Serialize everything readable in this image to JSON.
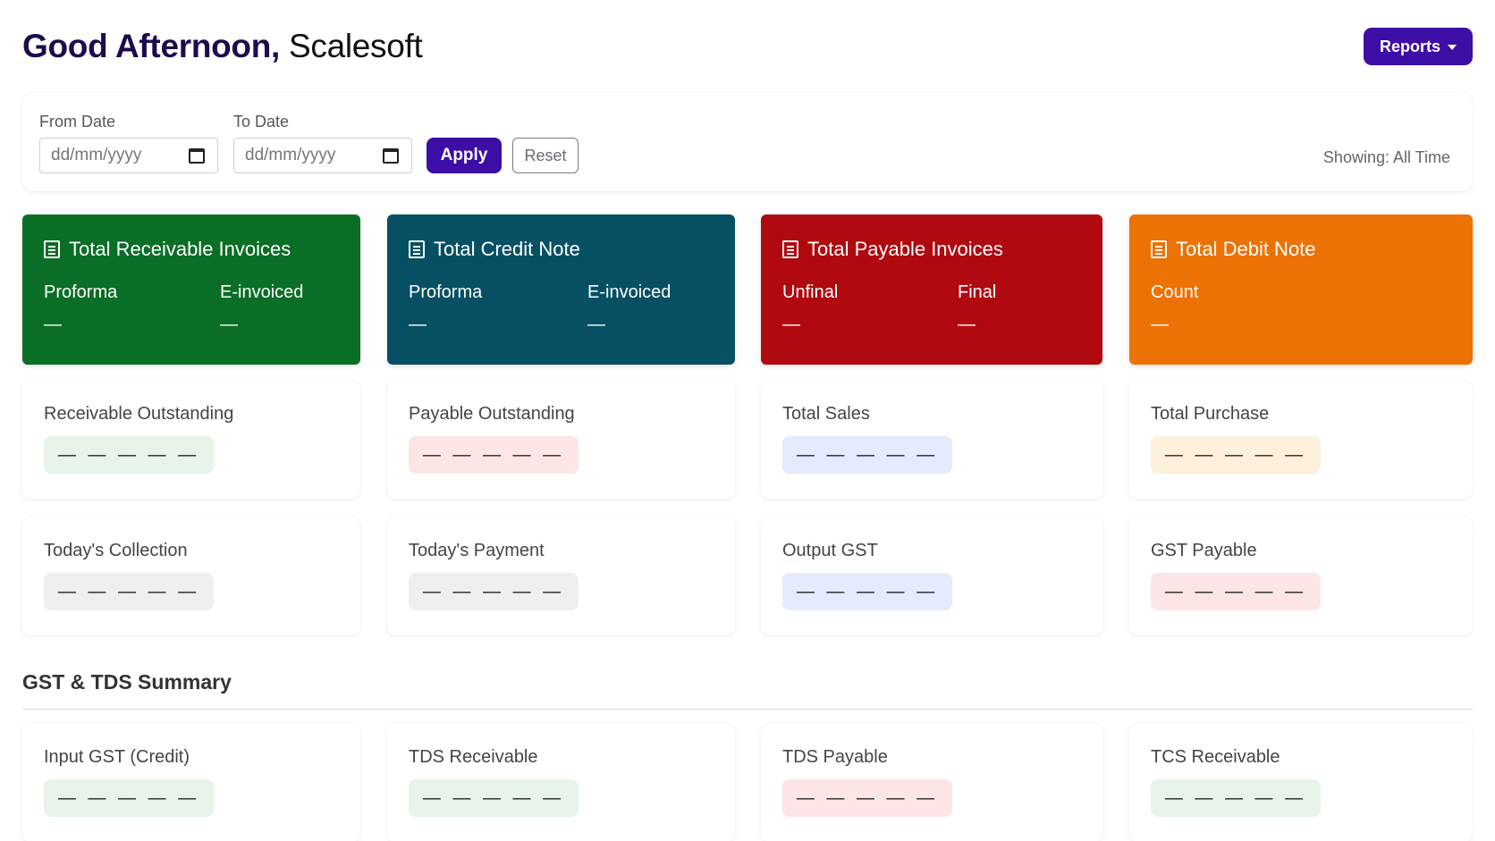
{
  "header": {
    "greeting": "Good Afternoon,",
    "name": "Scalesoft",
    "reports_label": "Reports"
  },
  "filters": {
    "from_label": "From Date",
    "from_placeholder": "dd/mm/yyyy",
    "to_label": "To Date",
    "to_placeholder": "dd/mm/yyyy",
    "apply_label": "Apply",
    "reset_label": "Reset",
    "showing": "Showing: All Time"
  },
  "summary_cards": [
    {
      "title": "Total Receivable Invoices",
      "color": "#0b6e26",
      "col1_label": "Proforma",
      "col1_value": "—",
      "col2_label": "E-invoiced",
      "col2_value": "—"
    },
    {
      "title": "Total Credit Note",
      "color": "#075063",
      "col1_label": "Proforma",
      "col1_value": "—",
      "col2_label": "E-invoiced",
      "col2_value": "—"
    },
    {
      "title": "Total Payable Invoices",
      "color": "#b00a10",
      "col1_label": "Unfinal",
      "col1_value": "—",
      "col2_label": "Final",
      "col2_value": "—"
    },
    {
      "title": "Total Debit Note",
      "color": "#ec7205",
      "col1_label": "Count",
      "col1_value": "—"
    }
  ],
  "stats_row1": [
    {
      "label": "Receivable Outstanding",
      "value": "— — — — —",
      "pill_color": "#e6f4ea"
    },
    {
      "label": "Payable Outstanding",
      "value": "— — — — —",
      "pill_color": "#fde5e5"
    },
    {
      "label": "Total Sales",
      "value": "— — — — —",
      "pill_color": "#e3ebfc"
    },
    {
      "label": "Total Purchase",
      "value": "— — — — —",
      "pill_color": "#fdf1dc"
    }
  ],
  "stats_row2": [
    {
      "label": "Today's Collection",
      "value": "— — — — —",
      "pill_color": "#efefef"
    },
    {
      "label": "Today's Payment",
      "value": "— — — — —",
      "pill_color": "#efefef"
    },
    {
      "label": "Output GST",
      "value": "— — — — —",
      "pill_color": "#e3ebfc"
    },
    {
      "label": "GST Payable",
      "value": "— — — — —",
      "pill_color": "#fde5e5"
    }
  ],
  "gst_section": {
    "title": "GST & TDS Summary",
    "cards": [
      {
        "label": "Input GST (Credit)",
        "value": "— — — — —",
        "pill_color": "#e6f4ea"
      },
      {
        "label": "TDS Receivable",
        "value": "— — — — —",
        "pill_color": "#e6f4ea"
      },
      {
        "label": "TDS Payable",
        "value": "— — — — —",
        "pill_color": "#fde5e5"
      },
      {
        "label": "TCS Receivable",
        "value": "— — — — —",
        "pill_color": "#e6f4ea"
      }
    ]
  }
}
